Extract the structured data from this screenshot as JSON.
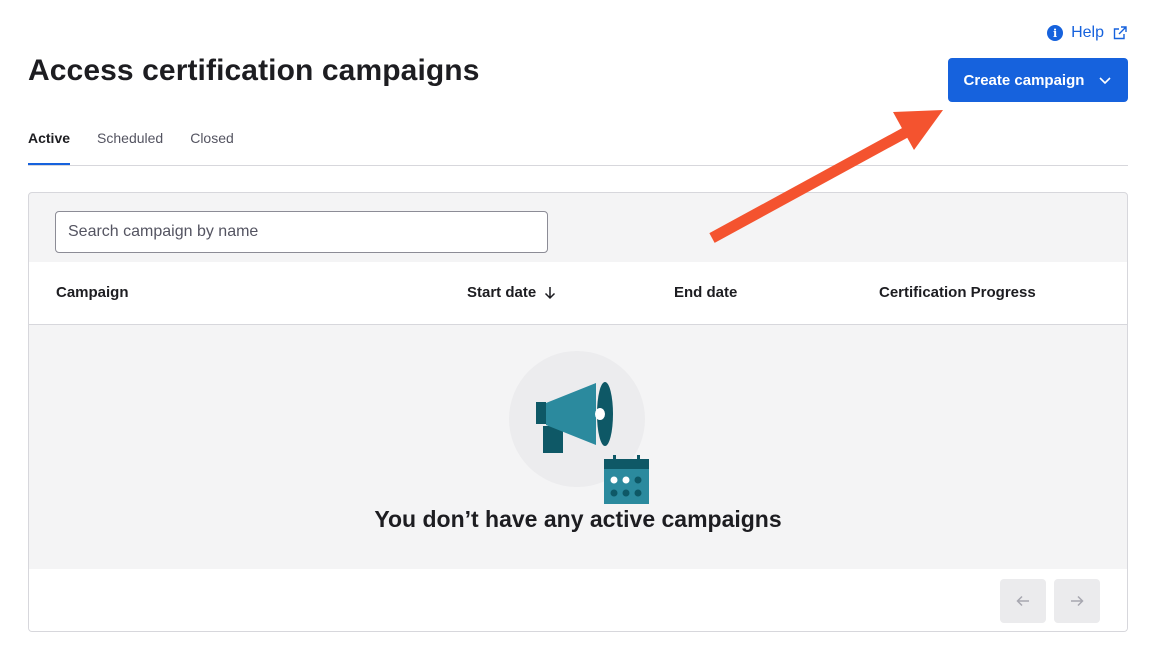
{
  "help": {
    "label": "Help",
    "icon": "info-icon",
    "external_icon": "external-link-icon"
  },
  "page": {
    "title": "Access certification campaigns"
  },
  "create_button": {
    "label": "Create campaign",
    "icon": "chevron-down-icon"
  },
  "tabs": [
    {
      "label": "Active",
      "active": true
    },
    {
      "label": "Scheduled",
      "active": false
    },
    {
      "label": "Closed",
      "active": false
    }
  ],
  "search": {
    "placeholder": "Search campaign by name",
    "value": ""
  },
  "table": {
    "columns": [
      {
        "label": "Campaign"
      },
      {
        "label": "Start date",
        "sort": "descending",
        "sort_icon": "arrow-down-icon"
      },
      {
        "label": "End date"
      },
      {
        "label": "Certification Progress"
      }
    ]
  },
  "empty_state": {
    "message": "You don’t have any active campaigns",
    "illustration": "megaphone-calendar-illustration"
  },
  "pagination": {
    "prev_icon": "arrow-left-icon",
    "next_icon": "arrow-right-icon"
  },
  "colors": {
    "accent": "#1662dd",
    "annotation_arrow": "#f4532f",
    "illustration_teal": "#2b8a9e",
    "illustration_dark": "#0e5866"
  }
}
